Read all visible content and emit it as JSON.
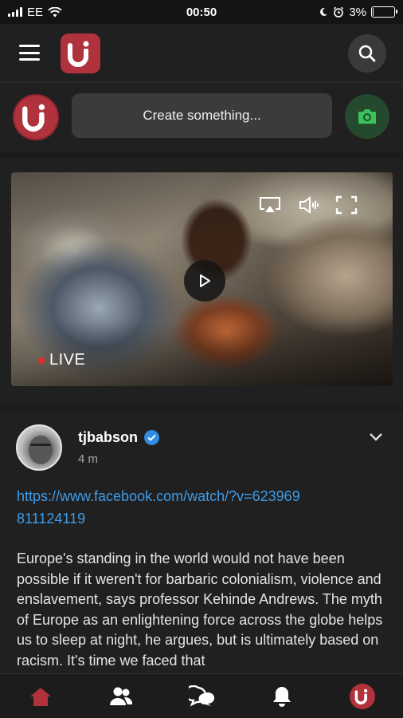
{
  "status_bar": {
    "carrier": "EE",
    "time": "00:50",
    "battery_percent": "3%",
    "battery_level": 0.03
  },
  "header": {
    "menu_icon": "hamburger-icon",
    "logo_icon": "u-logo-icon",
    "search_icon": "search-icon"
  },
  "composer": {
    "placeholder": "Create something...",
    "camera_icon": "camera-icon"
  },
  "video": {
    "live_label": "LIVE",
    "controls": [
      "airplay-icon",
      "volume-icon",
      "fullscreen-icon"
    ],
    "play_icon": "play-icon"
  },
  "post": {
    "username": "tjbabson",
    "time": "4 m",
    "link": "https://www.facebook.com/watch/?v=623969811124119",
    "body": "Europe's standing in the world would not have been possible if it weren't for barbaric colonialism, violence and enslavement, says professor Kehinde Andrews. The myth of Europe as an enlightening force across the globe helps us to sleep at night, he argues, but is ultimately based on racism. It's time we faced that"
  },
  "nav": {
    "items": [
      "home-icon",
      "friends-icon",
      "messages-icon",
      "notifications-icon",
      "profile-logo-icon"
    ]
  },
  "colors": {
    "brand": "#b0323c",
    "link": "#3f9be8",
    "live_dot": "#e52b2b",
    "verified": "#2f8ce3",
    "camera_bg": "#24492c",
    "camera_icon": "#39c35a"
  }
}
